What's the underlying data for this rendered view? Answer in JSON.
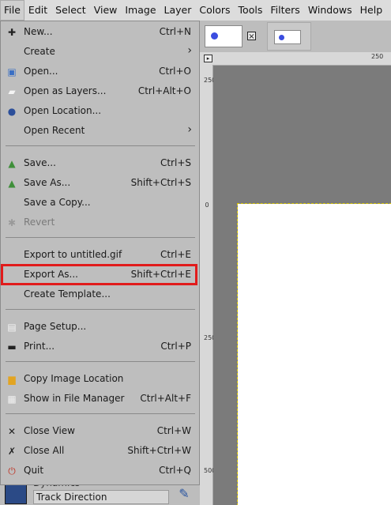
{
  "menubar": {
    "items": [
      "File",
      "Edit",
      "Select",
      "View",
      "Image",
      "Layer",
      "Colors",
      "Tools",
      "Filters",
      "Windows",
      "Help"
    ]
  },
  "file_menu": {
    "items": [
      {
        "label": "New...",
        "shortcut": "Ctrl+N",
        "icon": "new-icon"
      },
      {
        "label": "Create",
        "shortcut": "",
        "icon": "",
        "submenu": true
      },
      {
        "label": "Open...",
        "shortcut": "Ctrl+O",
        "icon": "open-icon"
      },
      {
        "label": "Open as Layers...",
        "shortcut": "Ctrl+Alt+O",
        "icon": "open-layers-icon"
      },
      {
        "label": "Open Location...",
        "shortcut": "",
        "icon": "globe-icon"
      },
      {
        "label": "Open Recent",
        "shortcut": "",
        "icon": "",
        "submenu": true
      },
      {
        "label": "Save...",
        "shortcut": "Ctrl+S",
        "icon": "save-icon"
      },
      {
        "label": "Save As...",
        "shortcut": "Shift+Ctrl+S",
        "icon": "save-as-icon"
      },
      {
        "label": "Save a Copy...",
        "shortcut": "",
        "icon": ""
      },
      {
        "label": "Revert",
        "shortcut": "",
        "icon": "revert-icon",
        "disabled": true
      },
      {
        "label": "Export to untitled.gif",
        "shortcut": "Ctrl+E",
        "icon": ""
      },
      {
        "label": "Export As...",
        "shortcut": "Shift+Ctrl+E",
        "icon": ""
      },
      {
        "label": "Create Template...",
        "shortcut": "",
        "icon": ""
      },
      {
        "label": "Page Setup...",
        "shortcut": "",
        "icon": "page-setup-icon"
      },
      {
        "label": "Print...",
        "shortcut": "Ctrl+P",
        "icon": "print-icon"
      },
      {
        "label": "Copy Image Location",
        "shortcut": "",
        "icon": "copy-location-icon"
      },
      {
        "label": "Show in File Manager",
        "shortcut": "Ctrl+Alt+F",
        "icon": "file-manager-icon"
      },
      {
        "label": "Close View",
        "shortcut": "Ctrl+W",
        "icon": "close-icon"
      },
      {
        "label": "Close All",
        "shortcut": "Shift+Ctrl+W",
        "icon": "close-all-icon"
      },
      {
        "label": "Quit",
        "shortcut": "Ctrl+Q",
        "icon": "quit-icon"
      }
    ]
  },
  "dock": {
    "label": "Dynamics",
    "field_value": "Track Direction"
  },
  "rulers": {
    "h_label": "250",
    "v_labels": [
      "250",
      "0",
      "250",
      "500"
    ]
  },
  "colors": {
    "highlight": "#e11b1b",
    "dot": "#3b4de0"
  }
}
